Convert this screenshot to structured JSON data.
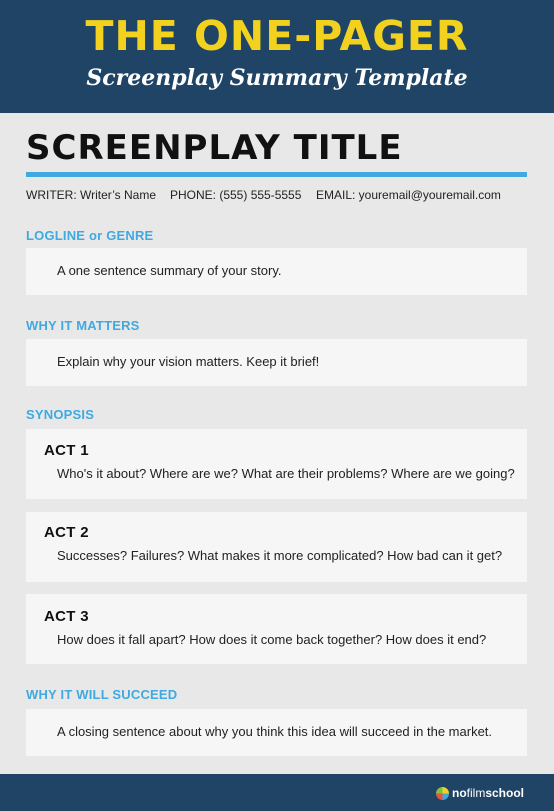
{
  "header": {
    "title": "THE ONE-PAGER",
    "subtitle": "Screenplay Summary Template"
  },
  "document": {
    "title": "SCREENPLAY TITLE",
    "writer": "WRITER: Writer’s Name",
    "phone": "PHONE: (555) 555-5555",
    "email": "EMAIL: youremail@youremail.com"
  },
  "logline": {
    "label": "LOGLINE or GENRE",
    "text": "A one sentence summary of your story."
  },
  "why_it_matters": {
    "label": "WHY IT MATTERS",
    "text": "Explain why your vision matters. Keep it brief!"
  },
  "synopsis": {
    "label": "SYNOPSIS",
    "acts": [
      {
        "title": "ACT 1",
        "text": "Who's it about? Where are we? What are their problems? Where are we going?"
      },
      {
        "title": "ACT 2",
        "text": "Successes? Failures? What makes it more complicated? How bad can it get?"
      },
      {
        "title": "ACT 3",
        "text": "How does it fall apart? How does it come back together? How does it end?"
      }
    ]
  },
  "why_it_will_succeed": {
    "label": "WHY IT WILL SUCCEED",
    "text": "A closing sentence about why you think this idea will succeed in the market."
  },
  "footer": {
    "logo_part1": "no",
    "logo_part2": "film",
    "logo_part3": "school"
  },
  "colors": {
    "header_bg": "#1f4466",
    "title_yellow": "#f2d21f",
    "accent_blue": "#3fa9e0"
  }
}
